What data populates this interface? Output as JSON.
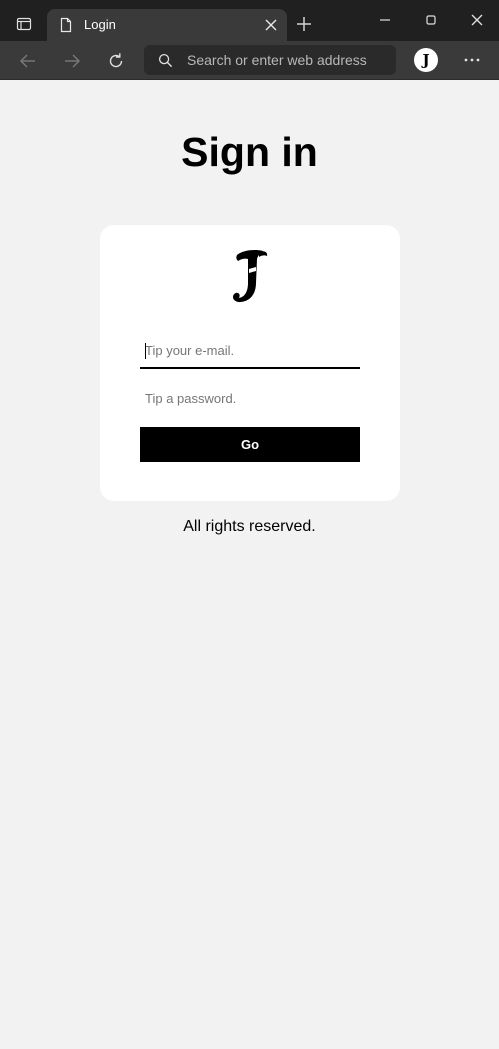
{
  "browser": {
    "tab_title": "Login",
    "address_placeholder": "Search or enter web address",
    "profile_initial": "J",
    "icons": {
      "tab_actions": "tab-actions-icon",
      "favicon": "page-icon",
      "tab_close": "close-icon",
      "new_tab": "plus-icon",
      "minimize": "minimize-icon",
      "maximize": "maximize-icon",
      "window_close": "close-icon",
      "back": "arrow-left-icon",
      "forward": "arrow-right-icon",
      "refresh": "refresh-icon",
      "search": "search-icon",
      "more": "more-icon"
    }
  },
  "page": {
    "title": "Sign in",
    "logo_letter": "J",
    "email_placeholder": "Tip your e-mail.",
    "password_placeholder": "Tip a password.",
    "submit_label": "Go",
    "footer": "All rights reserved."
  },
  "colors": {
    "page_background": "#f2f2f2",
    "card_background": "#ffffff",
    "button_background": "#000000",
    "button_text": "#ffffff",
    "chrome_titlebar": "#202020",
    "chrome_toolbar": "#3a3a3a"
  }
}
